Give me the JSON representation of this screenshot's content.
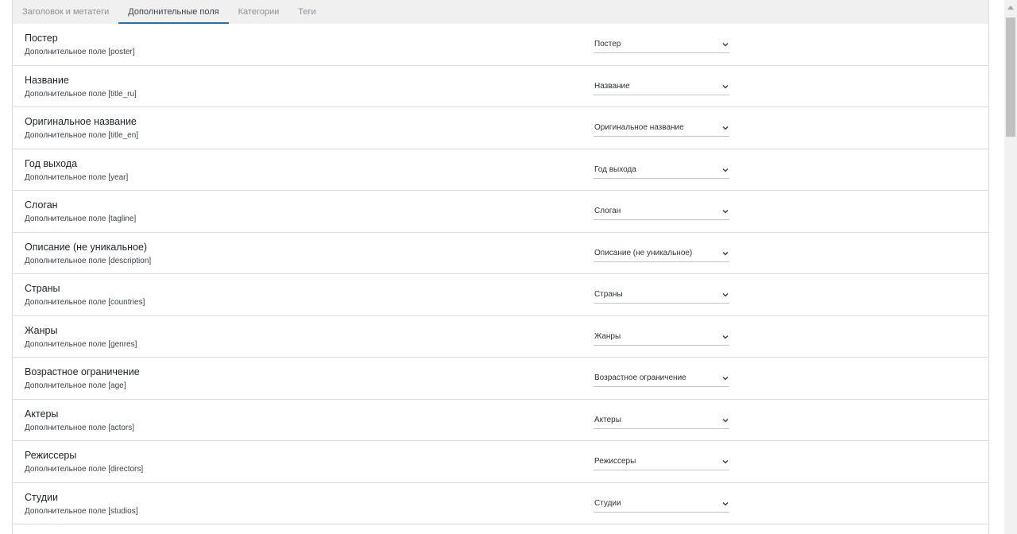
{
  "tabs": [
    {
      "label": "Заголовок и метатеги"
    },
    {
      "label": "Дополнительные поля",
      "active": true
    },
    {
      "label": "Категории"
    },
    {
      "label": "Теги"
    }
  ],
  "fields": [
    {
      "title": "Постер",
      "desc": "Дополнительное поле [poster]",
      "value": "Постер"
    },
    {
      "title": "Название",
      "desc": "Дополнительное поле [title_ru]",
      "value": "Название"
    },
    {
      "title": "Оригинальное название",
      "desc": "Дополнительное поле [title_en]",
      "value": "Оригинальное название"
    },
    {
      "title": "Год выхода",
      "desc": "Дополнительное поле [year]",
      "value": "Год выхода"
    },
    {
      "title": "Слоган",
      "desc": "Дополнительное поле [tagline]",
      "value": "Слоган"
    },
    {
      "title": "Описание (не уникальное)",
      "desc": "Дополнительное поле [description]",
      "value": "Описание (не уникальное)"
    },
    {
      "title": "Страны",
      "desc": "Дополнительное поле [countries]",
      "value": "Страны"
    },
    {
      "title": "Жанры",
      "desc": "Дополнительное поле [genres]",
      "value": "Жанры"
    },
    {
      "title": "Возрастное ограничение",
      "desc": "Дополнительное поле [age]",
      "value": "Возрастное ограничение"
    },
    {
      "title": "Актеры",
      "desc": "Дополнительное поле [actors]",
      "value": "Актеры"
    },
    {
      "title": "Режиссеры",
      "desc": "Дополнительное поле [directors]",
      "value": "Режиссеры"
    },
    {
      "title": "Студии",
      "desc": "Дополнительное поле [studios]",
      "value": "Студии"
    }
  ],
  "icons": {
    "dropdown": "chevron-down-icon",
    "scroll_up": "scroll-up-icon"
  },
  "colors": {
    "accent": "#2271b1",
    "border": "#dcdcde",
    "tab_bg": "#f0f0f1"
  }
}
